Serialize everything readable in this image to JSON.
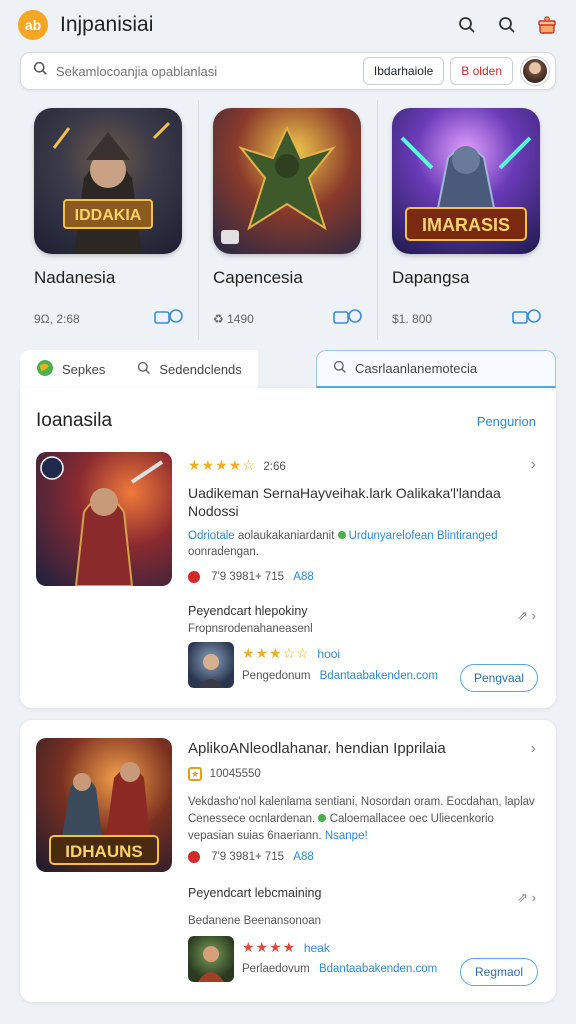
{
  "header": {
    "logo_text": "ab",
    "title": "Injpanisiai",
    "icons": [
      "search-icon",
      "search-icon",
      "gift-icon"
    ]
  },
  "search": {
    "placeholder": "Sekamlocoanjia opablanlasi",
    "pill_1": "Ibdarhaiole",
    "pill_2": "B olden"
  },
  "featured": [
    {
      "name": "Nadanesia",
      "meta": "9Ω, 2:68",
      "thumb_title": "IDDAKIA"
    },
    {
      "name": "Capencesia",
      "meta": "♻ 1490",
      "thumb_title": ""
    },
    {
      "name": "Dapangsa",
      "meta": "$1. 800",
      "thumb_title": "IMARASIS"
    }
  ],
  "tabs": [
    {
      "label": "Sepkes",
      "icon": "globe-icon"
    },
    {
      "label": "Sedendclends",
      "icon": "search-icon"
    },
    {
      "label": "Casrlaanlanemotecia",
      "icon": "search-icon"
    }
  ],
  "section1": {
    "heading": "Ioanasila",
    "link": "Pengurion",
    "app": {
      "stars": "★★★★☆",
      "rating": "2:66",
      "title": "Uadikeman SernaHayveihak.lark Oalikaka'l'landaa Nodossi",
      "desc_blue": "Odriotale",
      "desc_1": " aolaukakaniardanit ",
      "desc_blue2": "Urdunyarelofean Blintiranged",
      "desc_2": " oonradengan.",
      "stat": "7'9 3981+  715",
      "stat_blue": "A88",
      "sub_title": "Peyendcart hlepokiny",
      "sub_desc": "Fropnsrodenahaneasenl",
      "sub_stars": "★★★☆☆",
      "sub_star_label": "hooi",
      "sub_by": "Pengedonum",
      "sub_by_blue": "Bdantaabakenden.com",
      "btn": "Pengvaal"
    }
  },
  "section2": {
    "app": {
      "title": "AplikoANleodlahanar. hendian Ipprilaia",
      "badge": "10045550",
      "desc_1": "Vekdasho'nol kalenlama sentiani, Nosordan oram. Eocdahan, laplav",
      "desc_2": "Cenessece ocnlardenan.",
      "desc_blue": "Caloemallacee oec Uliecenkorio",
      "desc_3": "vepasian suias 6naeriann.",
      "desc_blue2": "Nsanpe!",
      "stat": "7'9 3981+  715",
      "stat_blue": "A88",
      "sub_title": "Peyendcart lebcmaining",
      "sub_desc": "Bedanene Beenansonoan",
      "sub_stars": "★★★★",
      "sub_star_label": "heak",
      "sub_by": "Perlaedovum",
      "sub_by_blue": "Bdantaabakenden.com",
      "btn": "Regmaol",
      "thumb_title": "IDHAUNS"
    }
  }
}
